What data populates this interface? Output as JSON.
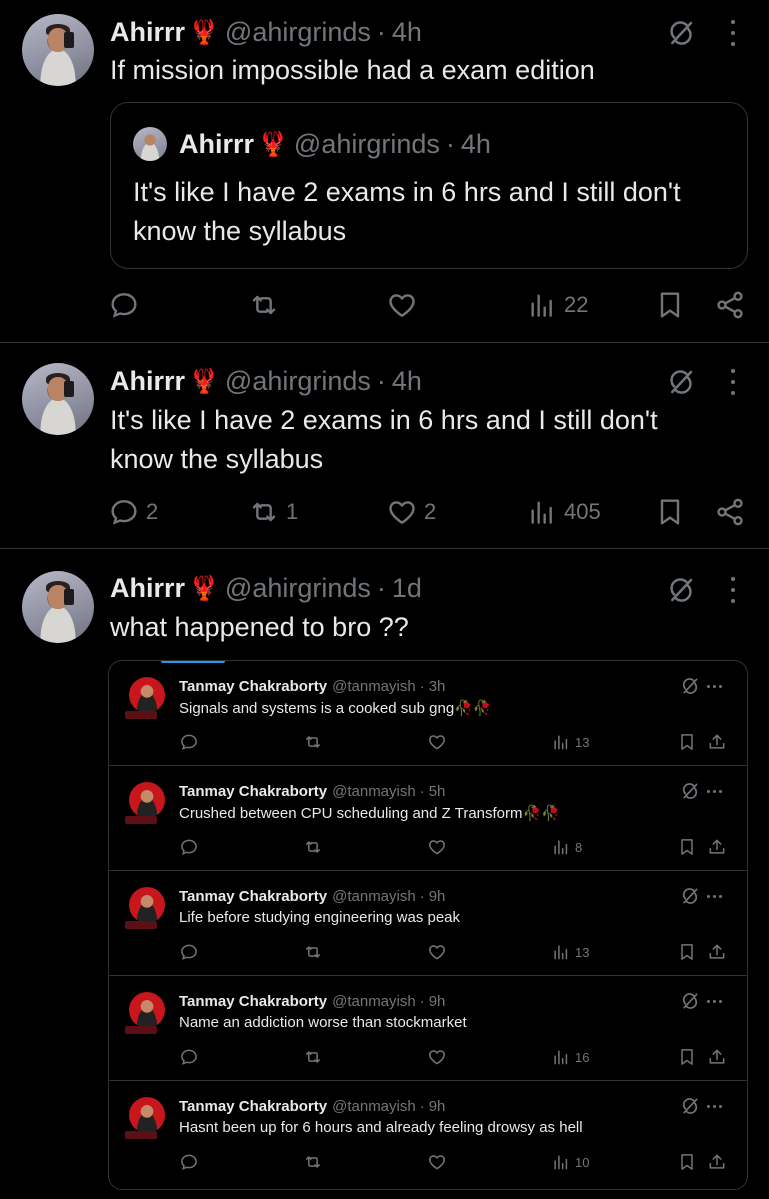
{
  "tweets": [
    {
      "name": "Ahirrr",
      "emoji": "🦞",
      "handle": "@ahirgrinds",
      "separator": "·",
      "time": "4h",
      "text": "If mission impossible had a exam edition",
      "quote": {
        "name": "Ahirrr",
        "emoji": "🦞",
        "handle": "@ahirgrinds",
        "separator": "·",
        "time": "4h",
        "text": "It's like I have 2 exams in 6 hrs and I still don't know the syllabus"
      },
      "stats": {
        "replies": "",
        "reposts": "",
        "likes": "",
        "views": "22"
      }
    },
    {
      "name": "Ahirrr",
      "emoji": "🦞",
      "handle": "@ahirgrinds",
      "separator": "·",
      "time": "4h",
      "text": "It's like I have 2 exams in 6 hrs and I still don't know the syllabus",
      "stats": {
        "replies": "2",
        "reposts": "1",
        "likes": "2",
        "views": "405"
      }
    },
    {
      "name": "Ahirrr",
      "emoji": "🦞",
      "handle": "@ahirgrinds",
      "separator": "·",
      "time": "1d",
      "text": "what happened to bro ??",
      "embedded_posts": [
        {
          "name": "Tanmay Chakraborty",
          "handle": "@tanmayish",
          "separator": "·",
          "time": "3h",
          "text": "Signals and systems is a cooked sub gng",
          "emoji": "🥀🥀",
          "views": "13"
        },
        {
          "name": "Tanmay Chakraborty",
          "handle": "@tanmayish",
          "separator": "·",
          "time": "5h",
          "text": "Crushed between CPU scheduling and Z Transform",
          "emoji": "🥀🥀",
          "views": "8"
        },
        {
          "name": "Tanmay Chakraborty",
          "handle": "@tanmayish",
          "separator": "·",
          "time": "9h",
          "text": "Life before studying engineering was peak",
          "emoji": "",
          "views": "13"
        },
        {
          "name": "Tanmay Chakraborty",
          "handle": "@tanmayish",
          "separator": "·",
          "time": "9h",
          "text": "Name an addiction worse than stockmarket",
          "emoji": "",
          "views": "16"
        },
        {
          "name": "Tanmay Chakraborty",
          "handle": "@tanmayish",
          "separator": "·",
          "time": "9h",
          "text": "Hasnt been up for 6 hours and already feeling drowsy as hell",
          "emoji": "",
          "views": "10"
        }
      ]
    }
  ],
  "icons": {
    "reply": "reply-icon",
    "repost": "repost-icon",
    "like": "heart-icon",
    "views": "views-icon",
    "bookmark": "bookmark-icon",
    "share": "share-icon",
    "grok": "grok-icon",
    "more": "more-icon"
  },
  "colors": {
    "background": "#000000",
    "text": "#e7e9ea",
    "muted": "#71767b",
    "border": "#2f3336",
    "accent": "#1d9bf0"
  }
}
